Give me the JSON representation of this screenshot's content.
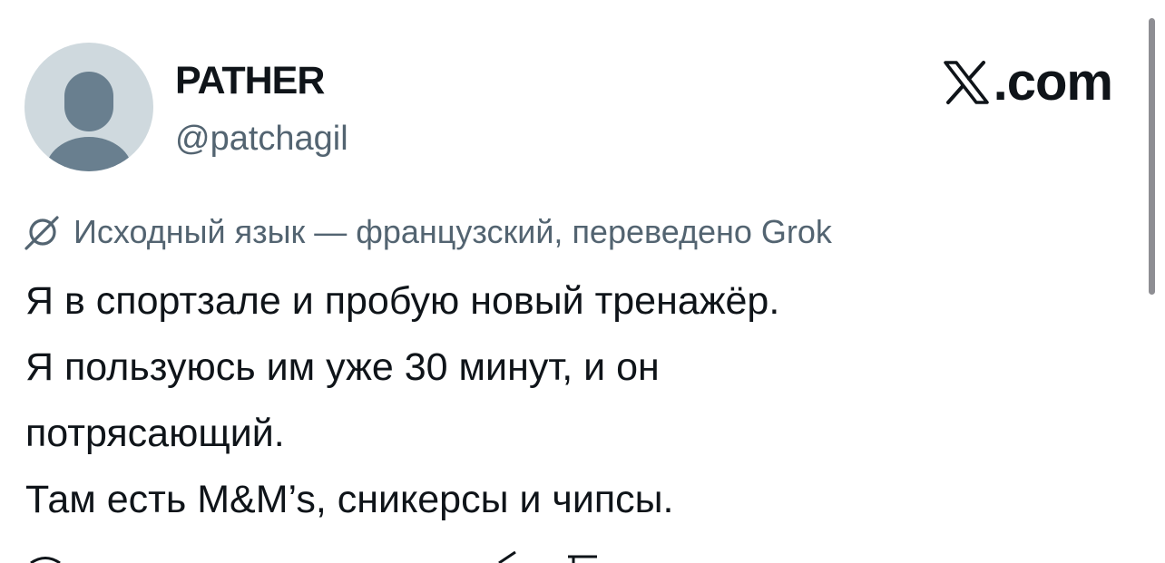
{
  "author": {
    "display_name": "PATHER",
    "handle": "@patchagil",
    "avatar": "default-profile-avatar"
  },
  "brand": {
    "icon": "x-logo-icon",
    "text": ".com"
  },
  "translation": {
    "icon": "translate-icon",
    "note": "Исходный язык — французский, переведено Grok"
  },
  "tweet": {
    "lines": [
      "Я в спортзале и пробую новый тренажёр.",
      "Я пользуюсь им уже 30 минут, и он",
      "потрясающий.",
      "Там есть M&M’s, сникерсы и чипсы."
    ]
  },
  "colors": {
    "text_primary": "#0f1419",
    "text_secondary": "#536471",
    "avatar_bg": "#cfd9de",
    "avatar_figure": "#697f8f"
  }
}
